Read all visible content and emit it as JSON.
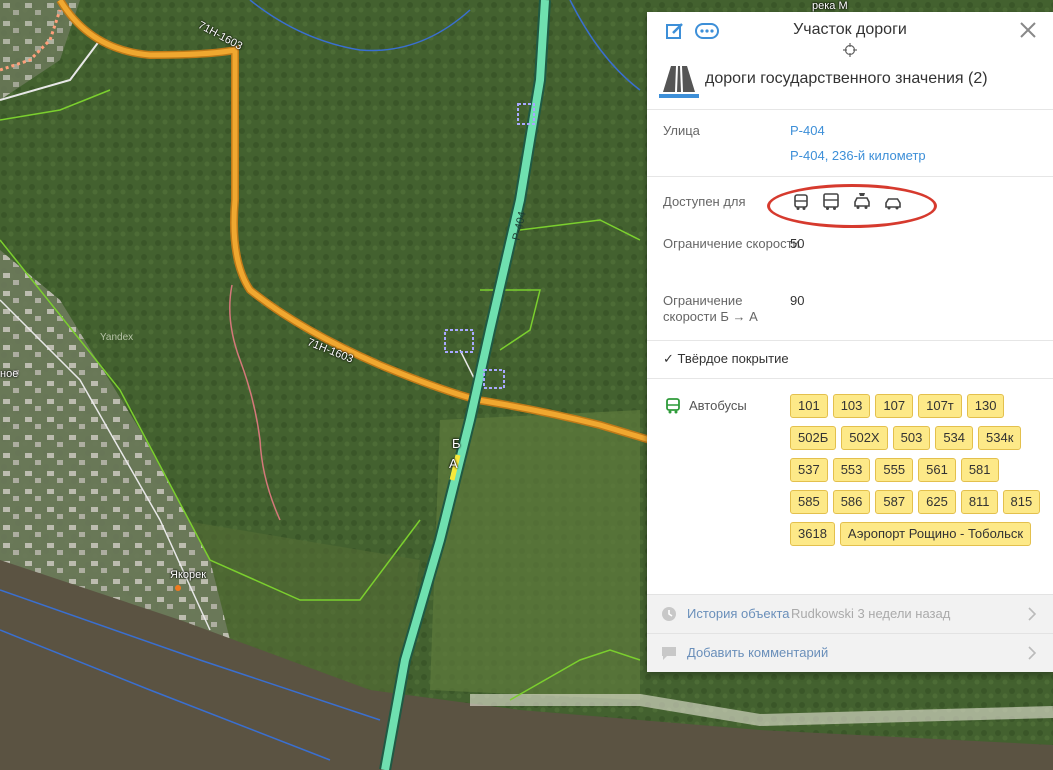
{
  "map": {
    "road_label_71h": "71Н-1603",
    "road_label_r404": "Р-404",
    "village_name": "Якорек",
    "village_partial": "ное",
    "river_partial": "река М",
    "watermark": "Yandex",
    "marker_b": "Б",
    "marker_a": "А"
  },
  "panel": {
    "title": "Участок дороги",
    "category": "дороги государственного значения (2)",
    "street_label": "Улица",
    "street_links": [
      "Р-404",
      "Р-404, 236-й километр"
    ],
    "access_label": "Доступен для",
    "access_icons": [
      "bus-icon",
      "truck-icon",
      "taxi-icon",
      "car-icon"
    ],
    "speed_label": "Ограничение скорости",
    "speed_value": "50",
    "speed_ba_label": "Ограничение скорости Б → А",
    "speed_ba_value": "90",
    "surface": "✓ Твёрдое покрытие",
    "buses_label": "Автобусы",
    "bus_routes": [
      "101",
      "103",
      "107",
      "107т",
      "130",
      "502Б",
      "502Х",
      "503",
      "534",
      "534к",
      "537",
      "553",
      "555",
      "561",
      "581",
      "585",
      "586",
      "587",
      "625",
      "811",
      "815",
      "3618",
      "Аэропорт Рощино - Тобольск"
    ],
    "history_label": "История объекта",
    "history_meta": "Rudkowski 3 недели назад",
    "comment_label": "Добавить комментарий"
  },
  "colors": {
    "link": "#3d8fd8",
    "chip_bg": "#fde988",
    "highlight_oval": "#d63a2e",
    "road_green": "#6fe0b0",
    "road_orange": "#f0a830"
  }
}
